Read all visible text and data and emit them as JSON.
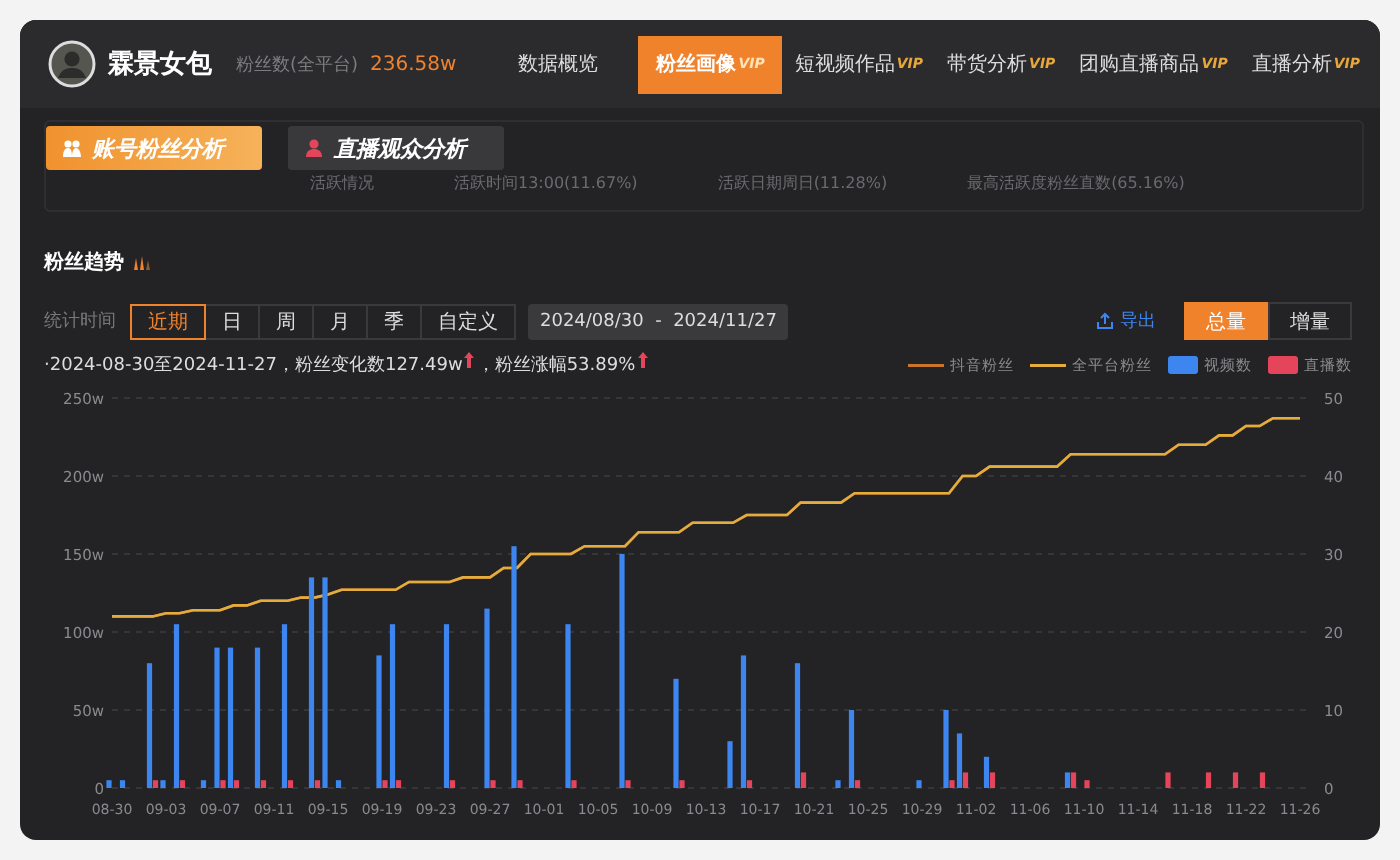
{
  "header": {
    "account_name": "霖景女包",
    "fans_label": "粉丝数(全平台)",
    "fans_value": "236.58w"
  },
  "nav_tabs": [
    {
      "label": "数据概览",
      "selected": false
    },
    {
      "label": "粉丝画像",
      "badge": "VIP",
      "selected": true
    },
    {
      "label": "短视频作品",
      "badge": "VIP",
      "selected": false
    },
    {
      "label": "带货分析",
      "badge": "VIP",
      "selected": false
    },
    {
      "label": "团购直播商品",
      "badge": "VIP",
      "selected": false
    },
    {
      "label": "直播分析",
      "badge": "VIP",
      "selected": false
    }
  ],
  "sub_tabs": [
    {
      "label": "账号粉丝分析",
      "selected": true
    },
    {
      "label": "直播观众分析",
      "selected": false
    }
  ],
  "activity_row": [
    "活跃情况",
    "活跃时间13:00(11.67%)",
    "活跃日期周日(11.28%)",
    "最高活跃度粉丝直数(65.16%)"
  ],
  "trend": {
    "title": "粉丝趋势",
    "period_label": "统计时间",
    "periods": [
      {
        "label": "近期",
        "selected": true
      },
      {
        "label": "日",
        "selected": false
      },
      {
        "label": "周",
        "selected": false
      },
      {
        "label": "月",
        "selected": false
      },
      {
        "label": "季",
        "selected": false
      },
      {
        "label": "自定义",
        "selected": false
      }
    ],
    "date_range": "2024/08/30  -  2024/11/27",
    "export": "导出",
    "modes": [
      {
        "label": "总量",
        "selected": true
      },
      {
        "label": "增量",
        "selected": false
      }
    ],
    "summary": [
      {
        "text": "·2024-08-30至2024-11-27，粉丝变化数127.49w",
        "rising": true
      },
      {
        "text": "，粉丝涨幅53.89%",
        "rising": true
      }
    ],
    "chart_data": {
      "type": "bar",
      "stacked": false,
      "grid": true,
      "categories": [
        "08-30",
        null,
        null,
        null,
        "09-03",
        null,
        null,
        null,
        "09-07",
        null,
        null,
        null,
        "09-11",
        null,
        null,
        null,
        "09-15",
        null,
        null,
        null,
        "09-19",
        null,
        null,
        null,
        "09-23",
        null,
        null,
        null,
        "09-27",
        null,
        null,
        null,
        "10-01",
        null,
        null,
        null,
        "10-05",
        null,
        null,
        null,
        "10-09",
        null,
        null,
        null,
        "10-13",
        null,
        null,
        null,
        "10-17",
        null,
        null,
        null,
        "10-21",
        null,
        null,
        null,
        "10-25",
        null,
        null,
        null,
        "10-29",
        null,
        null,
        null,
        "11-02",
        null,
        null,
        null,
        "11-06",
        null,
        null,
        null,
        "11-10",
        null,
        null,
        null,
        "11-14",
        null,
        null,
        null,
        "11-18",
        null,
        null,
        null,
        "11-22",
        null,
        null,
        null,
        "11-26"
      ],
      "ylim": [
        0,
        250
      ],
      "yticks": [
        {
          "value": 0,
          "label": "0"
        },
        {
          "value": 50,
          "label": "50w"
        },
        {
          "value": 100,
          "label": "100w"
        },
        {
          "value": 150,
          "label": "150w"
        },
        {
          "value": 200,
          "label": "200w"
        },
        {
          "value": 250,
          "label": "250w"
        }
      ],
      "y2lim": [
        0,
        50
      ],
      "y2ticks": [
        0,
        10,
        20,
        30,
        40,
        50
      ],
      "series": [
        {
          "name": "抖音粉丝",
          "type": "line",
          "color": "#c9762a",
          "values": [
            110,
            110,
            110,
            110,
            112,
            112,
            114,
            114,
            114,
            117,
            117,
            120,
            120,
            120,
            122,
            122,
            124,
            127,
            127,
            127,
            127,
            127,
            132,
            132,
            132,
            132,
            135,
            135,
            135,
            141,
            141,
            150,
            150,
            150,
            150,
            155,
            155,
            155,
            155,
            164,
            164,
            164,
            164,
            170,
            170,
            170,
            170,
            175,
            175,
            175,
            175,
            183,
            183,
            183,
            183,
            189,
            189,
            189,
            189,
            189,
            189,
            189,
            189,
            200,
            200,
            206,
            206,
            206,
            206,
            206,
            206,
            214,
            214,
            214,
            214,
            214,
            214,
            214,
            214,
            220,
            220,
            220,
            226,
            226,
            232,
            232,
            237,
            237,
            237
          ]
        },
        {
          "name": "全平台粉丝",
          "type": "line",
          "color": "#e3ac3c",
          "values": [
            110,
            110,
            110,
            110,
            112,
            112,
            114,
            114,
            114,
            117,
            117,
            120,
            120,
            120,
            122,
            122,
            124,
            127,
            127,
            127,
            127,
            127,
            132,
            132,
            132,
            132,
            135,
            135,
            135,
            141,
            141,
            150,
            150,
            150,
            150,
            155,
            155,
            155,
            155,
            164,
            164,
            164,
            164,
            170,
            170,
            170,
            170,
            175,
            175,
            175,
            175,
            183,
            183,
            183,
            183,
            189,
            189,
            189,
            189,
            189,
            189,
            189,
            189,
            200,
            200,
            206,
            206,
            206,
            206,
            206,
            206,
            214,
            214,
            214,
            214,
            214,
            214,
            214,
            214,
            220,
            220,
            220,
            226,
            226,
            232,
            232,
            237,
            237,
            237
          ]
        },
        {
          "name": "视频数",
          "type": "bar",
          "axis": "y2",
          "color": "#3d86f0",
          "values": [
            1,
            1,
            0,
            16,
            1,
            21,
            0,
            1,
            18,
            18,
            0,
            18,
            0,
            21,
            0,
            27,
            27,
            1,
            0,
            0,
            17,
            21,
            0,
            0,
            0,
            21,
            0,
            0,
            23,
            0,
            31,
            0,
            0,
            0,
            21,
            0,
            0,
            0,
            30,
            0,
            0,
            0,
            14,
            0,
            0,
            0,
            6,
            17,
            0,
            0,
            0,
            16,
            0,
            0,
            1,
            10,
            0,
            0,
            0,
            0,
            1,
            0,
            10,
            7,
            0,
            4,
            0,
            0,
            0,
            0,
            0,
            2,
            0,
            0,
            0,
            0,
            0,
            0,
            0,
            0,
            0,
            0,
            0,
            0,
            0,
            0,
            0,
            0,
            0
          ]
        },
        {
          "name": "直播数",
          "type": "bar",
          "axis": "y2",
          "color": "#e5455a",
          "values": [
            0,
            0,
            0,
            1,
            0,
            1,
            0,
            0,
            1,
            1,
            0,
            1,
            0,
            1,
            0,
            1,
            0,
            0,
            0,
            0,
            1,
            1,
            0,
            0,
            0,
            1,
            0,
            0,
            1,
            0,
            1,
            0,
            0,
            0,
            1,
            0,
            0,
            0,
            1,
            0,
            0,
            0,
            1,
            0,
            0,
            0,
            0,
            1,
            0,
            0,
            0,
            2,
            0,
            0,
            0,
            1,
            0,
            0,
            0,
            0,
            0,
            0,
            1,
            2,
            0,
            2,
            0,
            0,
            0,
            0,
            0,
            2,
            1,
            0,
            0,
            0,
            0,
            0,
            2,
            0,
            0,
            2,
            0,
            2,
            0,
            2,
            0,
            0,
            0
          ]
        }
      ]
    }
  }
}
